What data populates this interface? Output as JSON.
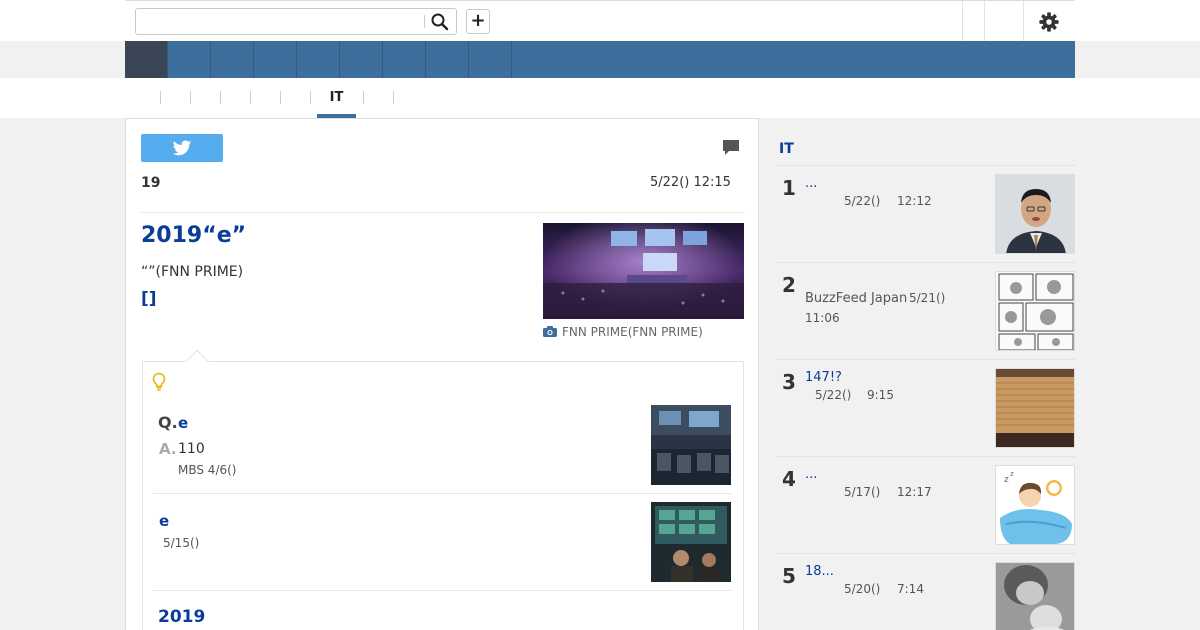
{
  "header": {
    "search": {
      "placeholder": "",
      "value": ""
    },
    "search_icon": "search-icon",
    "add_button": "+",
    "settings_icon": "gear-icon"
  },
  "subtabs": {
    "active_label": "IT"
  },
  "article": {
    "count": "19",
    "date": "5/22() 12:15",
    "headline": "2019“e”",
    "source": "“”(FNN PRIME)",
    "bracket_link": "[]",
    "photo_caption": "FNN PRIME(FNN PRIME)",
    "qa": {
      "q_label": "Q.",
      "q_text": "e",
      "a_label": "A.",
      "a_text": "110",
      "a_meta": "MBS 4/6()"
    },
    "related": [
      {
        "title": "e",
        "meta": "5/15()"
      },
      {
        "title": "2019"
      }
    ]
  },
  "sidebar": {
    "heading": "IT",
    "ranking": [
      {
        "num": "1",
        "title": "...",
        "date": "5/22()",
        "time": "12:12"
      },
      {
        "num": "2",
        "title": "BuzzFeed Japan",
        "date": "5/21()",
        "time": "11:06"
      },
      {
        "num": "3",
        "title": "147!?",
        "date": "5/22()",
        "time": "9:15"
      },
      {
        "num": "4",
        "title": "...",
        "date": "5/17()",
        "time": "12:17"
      },
      {
        "num": "5",
        "title": "18...",
        "date": "5/20()",
        "time": "7:14"
      }
    ]
  },
  "colors": {
    "nav_blue": "#3e6e9b",
    "nav_active": "#3a4656",
    "link_blue": "#0a3d99",
    "twitter": "#55acee"
  }
}
